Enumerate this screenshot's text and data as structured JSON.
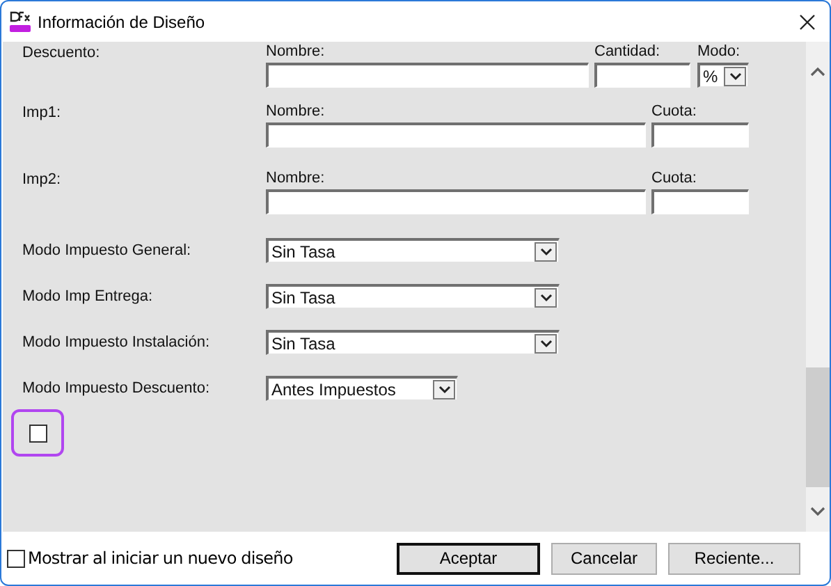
{
  "window": {
    "title": "Información de Diseño"
  },
  "charges": [
    {
      "label": "Descuento:",
      "fields": [
        {
          "kind": "text",
          "label": "Nombre:"
        },
        {
          "kind": "text",
          "label": "Cantidad:"
        },
        {
          "kind": "select",
          "label": "Modo:",
          "value": "%"
        }
      ]
    },
    {
      "label": "Imp1:",
      "fields": [
        {
          "kind": "text",
          "label": "Nombre:"
        },
        {
          "kind": "text",
          "label": "Cuota:"
        }
      ]
    },
    {
      "label": "Imp2:",
      "fields": [
        {
          "kind": "text",
          "label": "Nombre:"
        },
        {
          "kind": "text",
          "label": "Cuota:"
        }
      ]
    }
  ],
  "tax_modes": [
    {
      "label": "Modo Impuesto General:",
      "value": "Sin Tasa"
    },
    {
      "label": "Modo Imp Entrega:",
      "value": "Sin Tasa"
    },
    {
      "label": "Modo Impuesto Instalación:",
      "value": "Sin Tasa"
    },
    {
      "label": "Modo Impuesto Descuento:",
      "value": "Antes Impuestos"
    }
  ],
  "extra_checkbox": {
    "checked": false,
    "highlighted": true
  },
  "footer": {
    "checkbox": {
      "label": "Mostrar al iniciar un nuevo diseño",
      "checked": false
    },
    "buttons": [
      {
        "label": "Aceptar",
        "default": true
      },
      {
        "label": "Cancelar",
        "default": false
      },
      {
        "label": "Reciente...",
        "default": false
      }
    ]
  }
}
